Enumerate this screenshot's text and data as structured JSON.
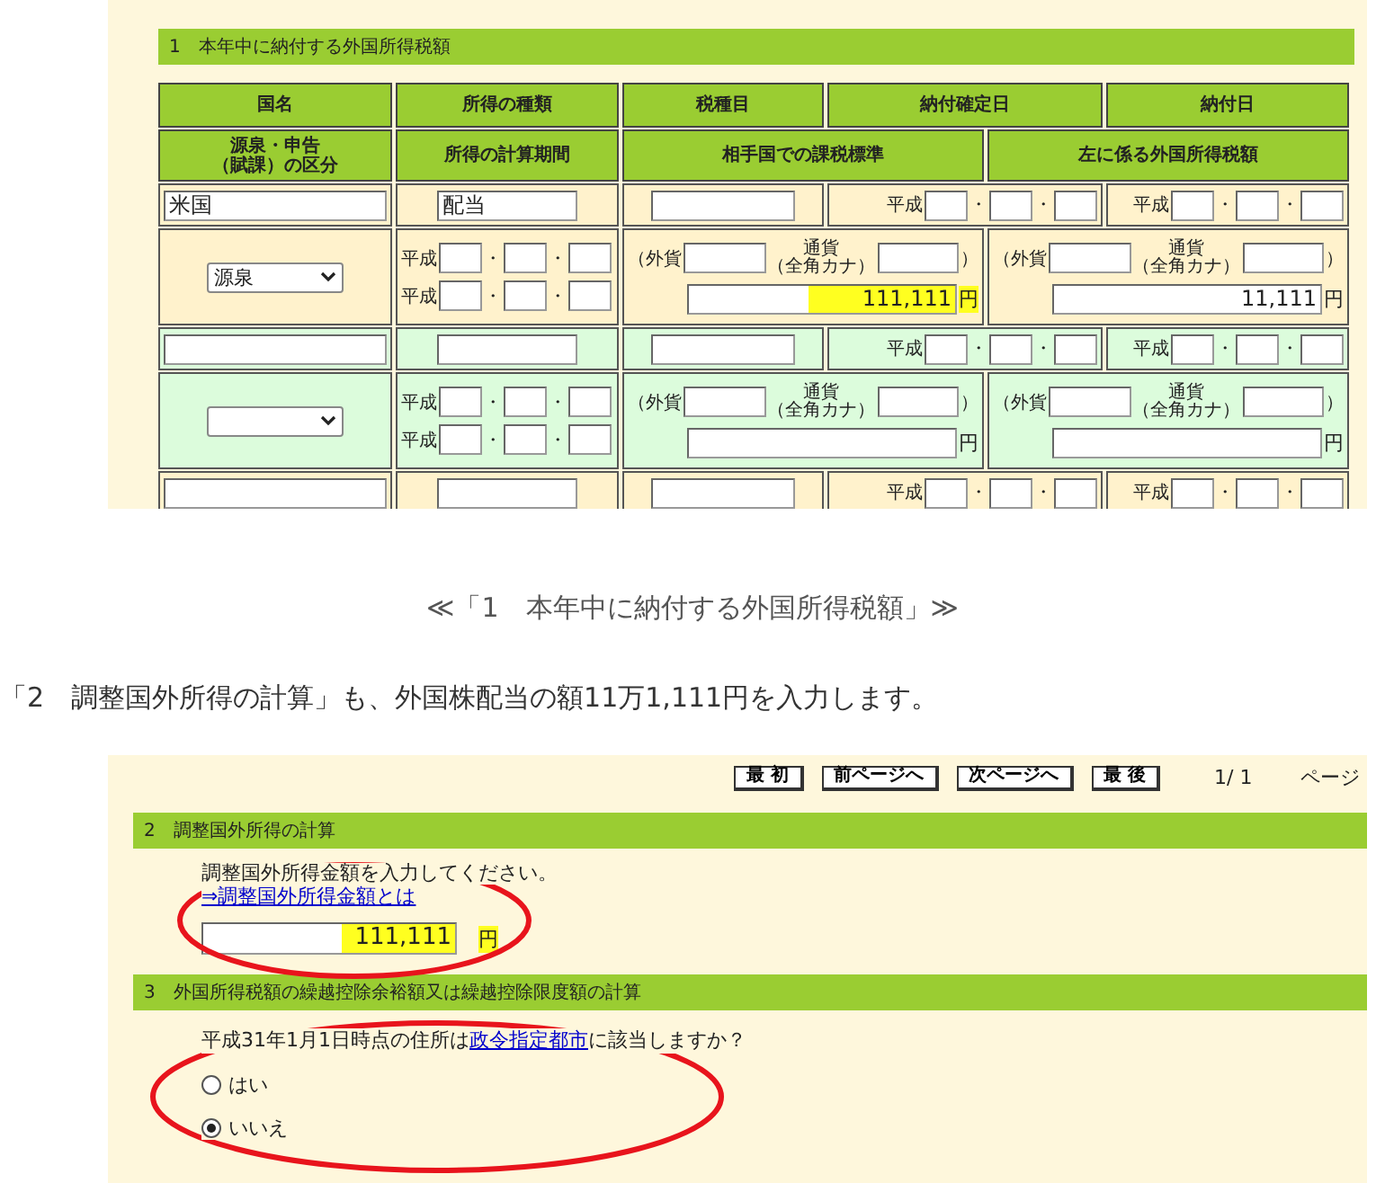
{
  "form1": {
    "section_title": "1　本年中に納付する外国所得税額",
    "header_row1": [
      "国名",
      "所得の種類",
      "税種目",
      "納付確定日",
      "納付日"
    ],
    "header_row2": [
      [
        "源泉・申告",
        "（賦課）の区分"
      ],
      [
        "所得の計算期間"
      ],
      [
        "相手国での課税標準"
      ],
      [
        "左に係る外国所得税額"
      ]
    ],
    "records": [
      {
        "color": "#fff2cc",
        "country": "米国",
        "income_type": "配当",
        "confirm_date": {
          "era": "平成",
          "separators": [
            "・",
            "・"
          ]
        },
        "pay_date": {
          "era": "平成",
          "separators": [
            "・",
            "・"
          ]
        },
        "division": "源泉",
        "period": [
          {
            "era": "平成",
            "separators": [
              "・",
              "・"
            ]
          },
          {
            "era": "平成",
            "separators": [
              "・",
              "・"
            ]
          }
        ],
        "base": {
          "foreign_label": "（外貨",
          "currency_label": [
            "通貨",
            "（全角カナ）"
          ],
          "close": "）",
          "amount": "111,111",
          "unit": "円",
          "highlight": true
        },
        "tax": {
          "foreign_label": "（外貨",
          "currency_label": [
            "通貨",
            "（全角カナ）"
          ],
          "close": "）",
          "amount": "11,111",
          "unit": "円",
          "highlight": false
        }
      },
      {
        "color": "#dcfcdc",
        "confirm_date": {
          "era": "平成",
          "separators": [
            "・",
            "・"
          ]
        },
        "pay_date": {
          "era": "平成",
          "separators": [
            "・",
            "・"
          ]
        },
        "period": [
          {
            "era": "平成",
            "separators": [
              "・",
              "・"
            ]
          },
          {
            "era": "平成",
            "separators": [
              "・",
              "・"
            ]
          }
        ],
        "base": {
          "foreign_label": "（外貨",
          "currency_label": [
            "通貨",
            "（全角カナ）"
          ],
          "close": "）",
          "unit": "円",
          "highlight": false
        },
        "tax": {
          "foreign_label": "（外貨",
          "currency_label": [
            "通貨",
            "（全角カナ）"
          ],
          "close": "）",
          "unit": "円",
          "highlight": false
        }
      },
      {
        "color": "#fff2cc",
        "confirm_date": {
          "era": "平成",
          "separators": [
            "・",
            "・"
          ]
        },
        "pay_date": {
          "era": "平成",
          "separators": [
            "・",
            "・"
          ]
        }
      }
    ]
  },
  "caption": "≪「1　本年中に納付する外国所得税額」≫",
  "paragraph": "「2　調整国外所得の計算」も、外国株配当の額11万1,111円を入力します。",
  "form2": {
    "nav_buttons": [
      "最 初",
      "前ページへ",
      "次ページへ",
      "最 後"
    ],
    "page_count": "1/ 1",
    "page_label": "ページ",
    "adjust": {
      "title": "2　調整国外所得の計算",
      "prompt": "調整国外所得金額を入力してください。",
      "link": "⇒調整国外所得金額とは",
      "amount": "111,111",
      "unit": "円",
      "highlight": true
    },
    "carryover": {
      "title": "3　外国所得税額の繰越控除余裕額又は繰越控除限度額の計算",
      "question_before": "平成31年1月1日時点の住所は",
      "question_link": "政令指定都市",
      "question_after": "に該当しますか？",
      "options": [
        {
          "label": "はい",
          "selected": false
        },
        {
          "label": "いいえ",
          "selected": true
        }
      ]
    }
  }
}
